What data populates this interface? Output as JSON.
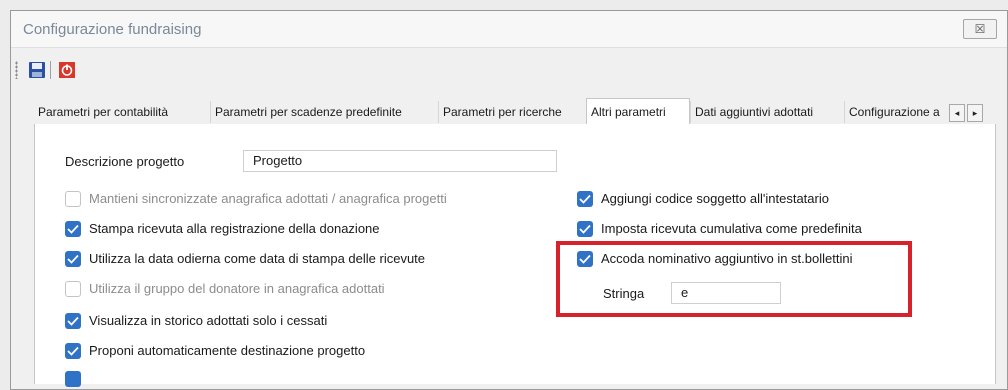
{
  "window": {
    "title": "Configurazione fundraising",
    "close_label": "☒"
  },
  "toolbar": {
    "save_icon": "save-icon",
    "exit_icon": "power-icon"
  },
  "tabs": [
    {
      "label": "Parametri per contabilità",
      "active": false
    },
    {
      "label": "Parametri per scadenze predefinite",
      "active": false
    },
    {
      "label": "Parametri per ricerche",
      "active": false
    },
    {
      "label": "Altri parametri",
      "active": true
    },
    {
      "label": "Dati aggiuntivi adottati",
      "active": false
    },
    {
      "label": "Configurazione a",
      "active": false
    }
  ],
  "tab_scroll": {
    "left": "◂",
    "right": "▸"
  },
  "form": {
    "descrizione_label": "Descrizione progetto",
    "descrizione_value": "Progetto",
    "left_options": [
      {
        "label": "Mantieni sincronizzate anagrafica adottati / anagrafica progetti",
        "checked": false,
        "enabled": false
      },
      {
        "label": "Stampa ricevuta alla registrazione della donazione",
        "checked": true,
        "enabled": true
      },
      {
        "label": "Utilizza la data odierna come data di stampa delle ricevute",
        "checked": true,
        "enabled": true
      },
      {
        "label": "Utilizza il gruppo del donatore in anagrafica adottati",
        "checked": false,
        "enabled": false
      },
      {
        "label": "Visualizza in storico adottati solo i cessati",
        "checked": true,
        "enabled": true
      },
      {
        "label": "Proponi automaticamente destinazione progetto",
        "checked": true,
        "enabled": true
      }
    ],
    "right_options": [
      {
        "label": "Aggiungi codice soggetto all'intestatario",
        "checked": true,
        "enabled": true
      },
      {
        "label": "Imposta ricevuta cumulativa come predefinita",
        "checked": true,
        "enabled": true
      },
      {
        "label": "Accoda nominativo aggiuntivo in st.bollettini",
        "checked": true,
        "enabled": true
      }
    ],
    "stringa_label": "Stringa",
    "stringa_value": "e"
  },
  "colors": {
    "checkbox_on": "#2f72c6",
    "highlight": "#d7222b"
  }
}
